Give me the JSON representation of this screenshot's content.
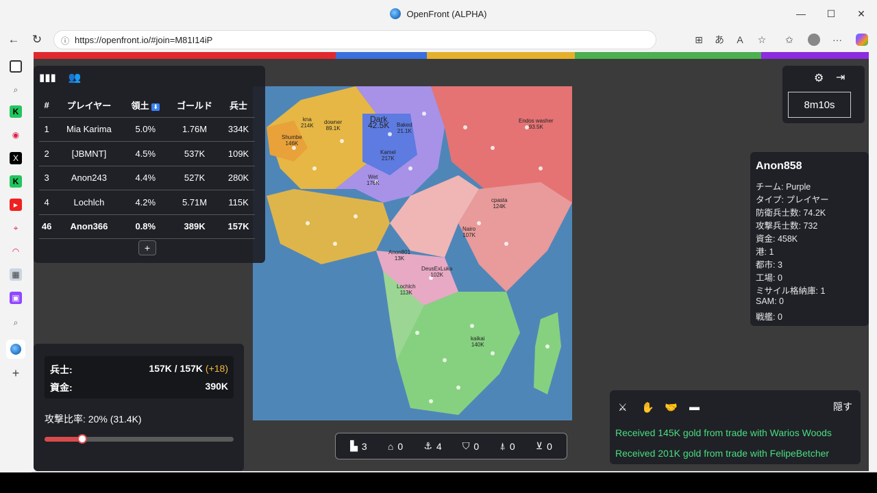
{
  "browser": {
    "title": "OpenFront (ALPHA)",
    "url": "https://openfront.io/#join=M81I14iP"
  },
  "team_bar_colors": [
    "#e0282e",
    "#3b6fdc",
    "#e6b02c",
    "#4caf50",
    "#8c2be0"
  ],
  "leaderboard": {
    "headers": [
      "#",
      "プレイヤー",
      "領土",
      "ゴールド",
      "兵士"
    ],
    "sort_icon": "sort-down-icon",
    "rows": [
      {
        "rank": "1",
        "name": "Mia Karima",
        "territory": "5.0%",
        "gold": "1.76M",
        "troops": "334K"
      },
      {
        "rank": "2",
        "name": "[JBMNT]",
        "territory": "4.5%",
        "gold": "537K",
        "troops": "109K"
      },
      {
        "rank": "3",
        "name": "Anon243",
        "territory": "4.4%",
        "gold": "527K",
        "troops": "280K"
      },
      {
        "rank": "4",
        "name": "Lochlch",
        "territory": "4.2%",
        "gold": "5.71M",
        "troops": "115K"
      },
      {
        "rank": "46",
        "name": "Anon366",
        "territory": "0.8%",
        "gold": "389K",
        "troops": "157K"
      }
    ],
    "expand_label": "+"
  },
  "stats": {
    "troops_label": "兵士:",
    "troops_value": "157K / 157K",
    "troops_gain": "(+18)",
    "gold_label": "資金:",
    "gold_value": "390K",
    "attack_ratio_label": "攻撃比率: 20% (31.4K)",
    "attack_ratio": 0.2
  },
  "timer": "8m10s",
  "player_info": {
    "name": "Anon858",
    "lines": [
      "チーム: Purple",
      "タイプ: プレイヤー",
      "防衛兵士数: 74.2K",
      "攻撃兵士数: 732",
      "資金: 458K",
      "港: 1",
      "都市: 3",
      "工場: 0",
      "ミサイル格納庫: 1",
      "SAM: 0",
      "戦艦: 0"
    ]
  },
  "buildings": [
    {
      "icon": "city-icon",
      "count": "3"
    },
    {
      "icon": "factory-icon",
      "count": "0"
    },
    {
      "icon": "port-anchor-icon",
      "count": "4"
    },
    {
      "icon": "defense-shield-icon",
      "count": "0"
    },
    {
      "icon": "missile-silo-icon",
      "count": "0"
    },
    {
      "icon": "sam-launcher-icon",
      "count": "0"
    }
  ],
  "events": {
    "hide_label": "隠す",
    "messages": [
      "Received 145K gold from trade with Warios Woods",
      "Received 201K gold from trade with FelipeBetcher"
    ]
  },
  "map_labels": [
    {
      "name": "Dark",
      "troops": "42.5K"
    },
    {
      "name": "Baked",
      "troops": "21.1K"
    },
    {
      "name": "Kamel",
      "troops": "217K"
    },
    {
      "name": "Wet",
      "troops": "176K"
    },
    {
      "name": "Endos washer",
      "troops": "93.5K"
    },
    {
      "name": "cpasta",
      "troops": "124K"
    },
    {
      "name": "DeusExLuka",
      "troops": "102K"
    },
    {
      "name": "Lochlch",
      "troops": "113K"
    },
    {
      "name": "kaikai",
      "troops": "140K"
    },
    {
      "name": "Anon801",
      "troops": "13K"
    },
    {
      "name": "downer",
      "troops": "89.1K"
    },
    {
      "name": "Shumbe",
      "troops": "146K"
    },
    {
      "name": "Nairo",
      "troops": "107K"
    },
    {
      "name": "kna",
      "troops": "214K"
    }
  ]
}
